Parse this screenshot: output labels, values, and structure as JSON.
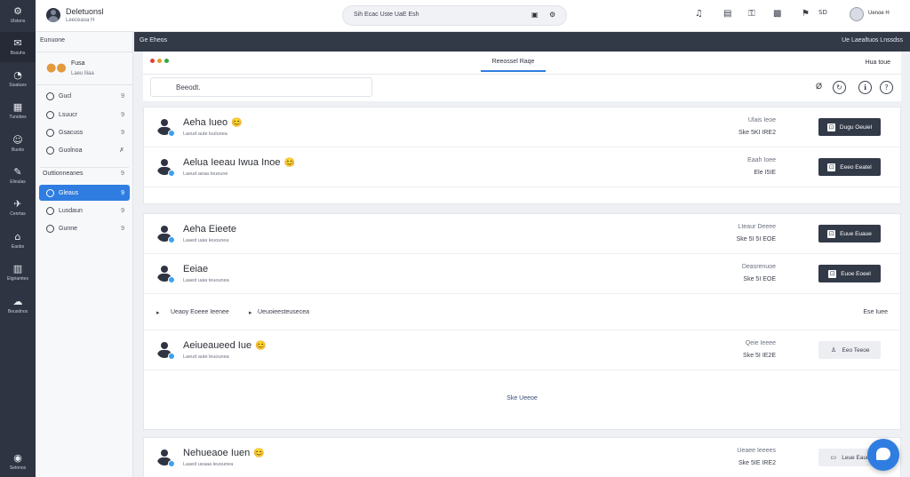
{
  "rail": {
    "items": [
      {
        "icon": "⚙",
        "label": "Ulstons"
      },
      {
        "icon": "✉",
        "label": "Bsouhs"
      },
      {
        "icon": "◔",
        "label": "Siuatues"
      },
      {
        "icon": "▦",
        "label": "Tunobes"
      },
      {
        "icon": "☺",
        "label": "Buotis"
      },
      {
        "icon": "✎",
        "label": "Elinulas"
      },
      {
        "icon": "✈",
        "label": "Cenrtas"
      },
      {
        "icon": "⌂",
        "label": "Eaobs"
      },
      {
        "icon": "▥",
        "label": "Etgriamtes"
      },
      {
        "icon": "☁",
        "label": "Beusdnos"
      }
    ],
    "bottom": {
      "icon": "◉",
      "label": "Setnnos"
    }
  },
  "topbar": {
    "user_name": "Deletuonsl",
    "user_sub": "Leeceaoa H",
    "search_placeholder": "Sih Ecac Uste UaE Esh",
    "right_user": "Uenoe H"
  },
  "sidebar": {
    "header": "Eunuone",
    "profile_label": "Fusa",
    "profile_sub": "Laeu lliaa",
    "items_top": [
      {
        "label": "Gucl",
        "count": "9"
      },
      {
        "label": "Lsuucr",
        "count": "9"
      },
      {
        "label": "Gsacuss",
        "count": "9"
      },
      {
        "label": "Guolnoa",
        "count": "✗"
      }
    ],
    "section_label": "Outtionneanes",
    "section_count": "9",
    "items_bottom": [
      {
        "label": "Gleaus",
        "count": "9",
        "active": true
      },
      {
        "label": "Lusdaun",
        "count": "9",
        "active": false
      },
      {
        "label": "Gunne",
        "count": "9",
        "active": false
      }
    ]
  },
  "main": {
    "headbar_title": "Ge Eheos",
    "headbar_right": "Ue Laealtuos Lnssdss",
    "tab_label": "Reeossel Raqe",
    "subbar_right": "Hua toue",
    "search_placeholder": "Beeodt."
  },
  "rows": [
    {
      "name": "Aeha Iueo",
      "emoji": "😊",
      "sub": "Laoud aute luulunea",
      "meta1": "Ulais Ieoe",
      "meta2": "Ske 5KI IRE2",
      "button": "Dugu Oeuiel",
      "button_icon": "⊡",
      "light": false
    },
    {
      "name": "Aelua Ieeau Iwua Inoe",
      "emoji": "😊",
      "sub": "Laeud aeaa toueune",
      "meta1": "Eaah Ioee",
      "meta2": "Ele I5IE",
      "button": "Eeeo Eeatel",
      "button_icon": "⊡",
      "light": false
    },
    {
      "name": "Aeha Eieete",
      "emoji": "",
      "sub": "Laaed uaia leuounea",
      "meta1": "Lteaur Deeee",
      "meta2": "Ske 5I 5I EOE",
      "button": "Euue Euaue",
      "button_icon": "⊡",
      "light": false
    },
    {
      "name": "Eeiae",
      "emoji": "",
      "sub": "Laaed uaia teuounea",
      "meta1": "Deasrenuoe",
      "meta2": "Ske 5I EOE",
      "button": "Euoe Eoeel",
      "button_icon": "⊡",
      "light": false
    },
    {
      "name": "Aeiueaueed Iue",
      "emoji": "😊",
      "sub": "Laeud aute leuounea",
      "meta1": "Qeie Ieeee",
      "meta2": "Ske 5I IE2E",
      "button": "Eeo Teeoe",
      "button_icon": "♙",
      "light": true
    },
    {
      "name": "Nehueaoe Iuen",
      "emoji": "😊",
      "sub": "Laaed ueaaa leuounea",
      "meta1": "Ueaee Ieeees",
      "meta2": "Ske 5IE IRE2",
      "button": "Leue Eaue",
      "button_icon": "▭",
      "light": true
    }
  ],
  "group": {
    "text": "Ueaoy Eoeee Ieenee",
    "text2": "Ueuoieesteusecea",
    "right": "Ese Iuee"
  },
  "more_label": "Ske Ueeoe"
}
